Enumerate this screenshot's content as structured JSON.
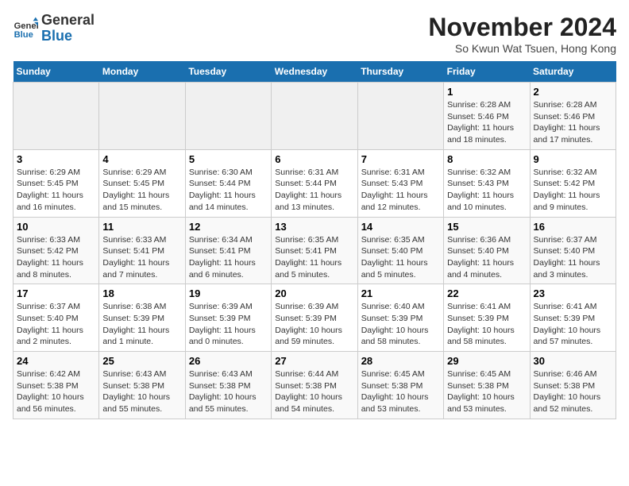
{
  "logo": {
    "text_general": "General",
    "text_blue": "Blue"
  },
  "title": "November 2024",
  "subtitle": "So Kwun Wat Tsuen, Hong Kong",
  "days_of_week": [
    "Sunday",
    "Monday",
    "Tuesday",
    "Wednesday",
    "Thursday",
    "Friday",
    "Saturday"
  ],
  "weeks": [
    [
      {
        "day": "",
        "info": ""
      },
      {
        "day": "",
        "info": ""
      },
      {
        "day": "",
        "info": ""
      },
      {
        "day": "",
        "info": ""
      },
      {
        "day": "",
        "info": ""
      },
      {
        "day": "1",
        "info": "Sunrise: 6:28 AM\nSunset: 5:46 PM\nDaylight: 11 hours and 18 minutes."
      },
      {
        "day": "2",
        "info": "Sunrise: 6:28 AM\nSunset: 5:46 PM\nDaylight: 11 hours and 17 minutes."
      }
    ],
    [
      {
        "day": "3",
        "info": "Sunrise: 6:29 AM\nSunset: 5:45 PM\nDaylight: 11 hours and 16 minutes."
      },
      {
        "day": "4",
        "info": "Sunrise: 6:29 AM\nSunset: 5:45 PM\nDaylight: 11 hours and 15 minutes."
      },
      {
        "day": "5",
        "info": "Sunrise: 6:30 AM\nSunset: 5:44 PM\nDaylight: 11 hours and 14 minutes."
      },
      {
        "day": "6",
        "info": "Sunrise: 6:31 AM\nSunset: 5:44 PM\nDaylight: 11 hours and 13 minutes."
      },
      {
        "day": "7",
        "info": "Sunrise: 6:31 AM\nSunset: 5:43 PM\nDaylight: 11 hours and 12 minutes."
      },
      {
        "day": "8",
        "info": "Sunrise: 6:32 AM\nSunset: 5:43 PM\nDaylight: 11 hours and 10 minutes."
      },
      {
        "day": "9",
        "info": "Sunrise: 6:32 AM\nSunset: 5:42 PM\nDaylight: 11 hours and 9 minutes."
      }
    ],
    [
      {
        "day": "10",
        "info": "Sunrise: 6:33 AM\nSunset: 5:42 PM\nDaylight: 11 hours and 8 minutes."
      },
      {
        "day": "11",
        "info": "Sunrise: 6:33 AM\nSunset: 5:41 PM\nDaylight: 11 hours and 7 minutes."
      },
      {
        "day": "12",
        "info": "Sunrise: 6:34 AM\nSunset: 5:41 PM\nDaylight: 11 hours and 6 minutes."
      },
      {
        "day": "13",
        "info": "Sunrise: 6:35 AM\nSunset: 5:41 PM\nDaylight: 11 hours and 5 minutes."
      },
      {
        "day": "14",
        "info": "Sunrise: 6:35 AM\nSunset: 5:40 PM\nDaylight: 11 hours and 5 minutes."
      },
      {
        "day": "15",
        "info": "Sunrise: 6:36 AM\nSunset: 5:40 PM\nDaylight: 11 hours and 4 minutes."
      },
      {
        "day": "16",
        "info": "Sunrise: 6:37 AM\nSunset: 5:40 PM\nDaylight: 11 hours and 3 minutes."
      }
    ],
    [
      {
        "day": "17",
        "info": "Sunrise: 6:37 AM\nSunset: 5:40 PM\nDaylight: 11 hours and 2 minutes."
      },
      {
        "day": "18",
        "info": "Sunrise: 6:38 AM\nSunset: 5:39 PM\nDaylight: 11 hours and 1 minute."
      },
      {
        "day": "19",
        "info": "Sunrise: 6:39 AM\nSunset: 5:39 PM\nDaylight: 11 hours and 0 minutes."
      },
      {
        "day": "20",
        "info": "Sunrise: 6:39 AM\nSunset: 5:39 PM\nDaylight: 10 hours and 59 minutes."
      },
      {
        "day": "21",
        "info": "Sunrise: 6:40 AM\nSunset: 5:39 PM\nDaylight: 10 hours and 58 minutes."
      },
      {
        "day": "22",
        "info": "Sunrise: 6:41 AM\nSunset: 5:39 PM\nDaylight: 10 hours and 58 minutes."
      },
      {
        "day": "23",
        "info": "Sunrise: 6:41 AM\nSunset: 5:39 PM\nDaylight: 10 hours and 57 minutes."
      }
    ],
    [
      {
        "day": "24",
        "info": "Sunrise: 6:42 AM\nSunset: 5:38 PM\nDaylight: 10 hours and 56 minutes."
      },
      {
        "day": "25",
        "info": "Sunrise: 6:43 AM\nSunset: 5:38 PM\nDaylight: 10 hours and 55 minutes."
      },
      {
        "day": "26",
        "info": "Sunrise: 6:43 AM\nSunset: 5:38 PM\nDaylight: 10 hours and 55 minutes."
      },
      {
        "day": "27",
        "info": "Sunrise: 6:44 AM\nSunset: 5:38 PM\nDaylight: 10 hours and 54 minutes."
      },
      {
        "day": "28",
        "info": "Sunrise: 6:45 AM\nSunset: 5:38 PM\nDaylight: 10 hours and 53 minutes."
      },
      {
        "day": "29",
        "info": "Sunrise: 6:45 AM\nSunset: 5:38 PM\nDaylight: 10 hours and 53 minutes."
      },
      {
        "day": "30",
        "info": "Sunrise: 6:46 AM\nSunset: 5:38 PM\nDaylight: 10 hours and 52 minutes."
      }
    ]
  ]
}
